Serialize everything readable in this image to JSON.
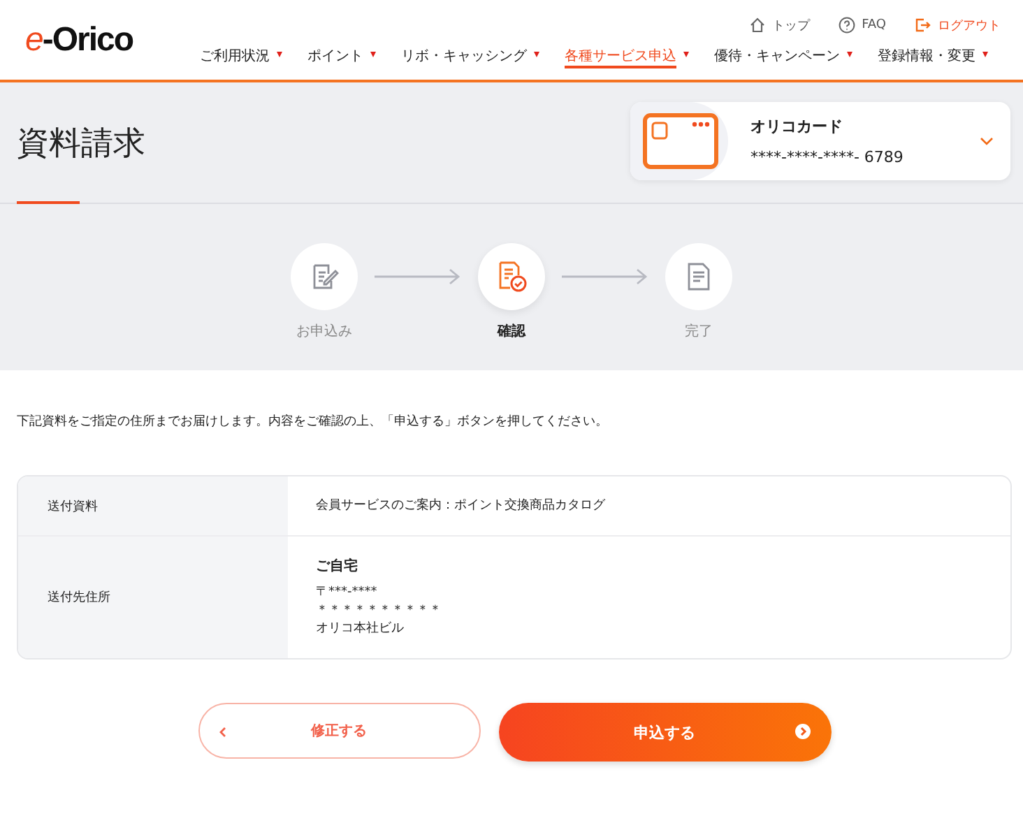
{
  "header": {
    "logo": {
      "accent": "e",
      "rest": "-Orico"
    },
    "utility_links": [
      {
        "kind": "home",
        "label": "トップ"
      },
      {
        "kind": "help",
        "label": "FAQ"
      },
      {
        "kind": "logout",
        "label": "ログアウト"
      }
    ],
    "nav": [
      {
        "label": "ご利用状況",
        "selected": false
      },
      {
        "label": "ポイント",
        "selected": false
      },
      {
        "label": "リボ・キャッシング",
        "selected": false
      },
      {
        "label": "各種サービス申込",
        "selected": true
      },
      {
        "label": "優待・キャンペーン",
        "selected": false
      },
      {
        "label": "登録情報・変更",
        "selected": false
      }
    ]
  },
  "page_title": "資料請求",
  "card_selector": {
    "name": "オリコカード",
    "number": "****-****-****- 6789"
  },
  "steps": [
    {
      "label": "お申込み",
      "kind": "form",
      "selected": false
    },
    {
      "label": "確認",
      "kind": "confirm",
      "selected": true
    },
    {
      "label": "完了",
      "kind": "done",
      "selected": false
    }
  ],
  "instruction": "下記資料をご指定の住所までお届けします。内容をご確認の上、「申込する」ボタンを押してください。",
  "table": {
    "rows": [
      {
        "label": "送付資料",
        "lines": [
          "会員サービスのご案内：ポイント交換商品カタログ"
        ]
      },
      {
        "label": "送付先住所",
        "heading": "ご自宅",
        "lines": [
          "〒***-****",
          "＊＊＊＊＊＊＊＊＊＊",
          "オリコ本社ビル"
        ]
      }
    ]
  },
  "buttons": {
    "back": "修正する",
    "submit": "申込する"
  }
}
